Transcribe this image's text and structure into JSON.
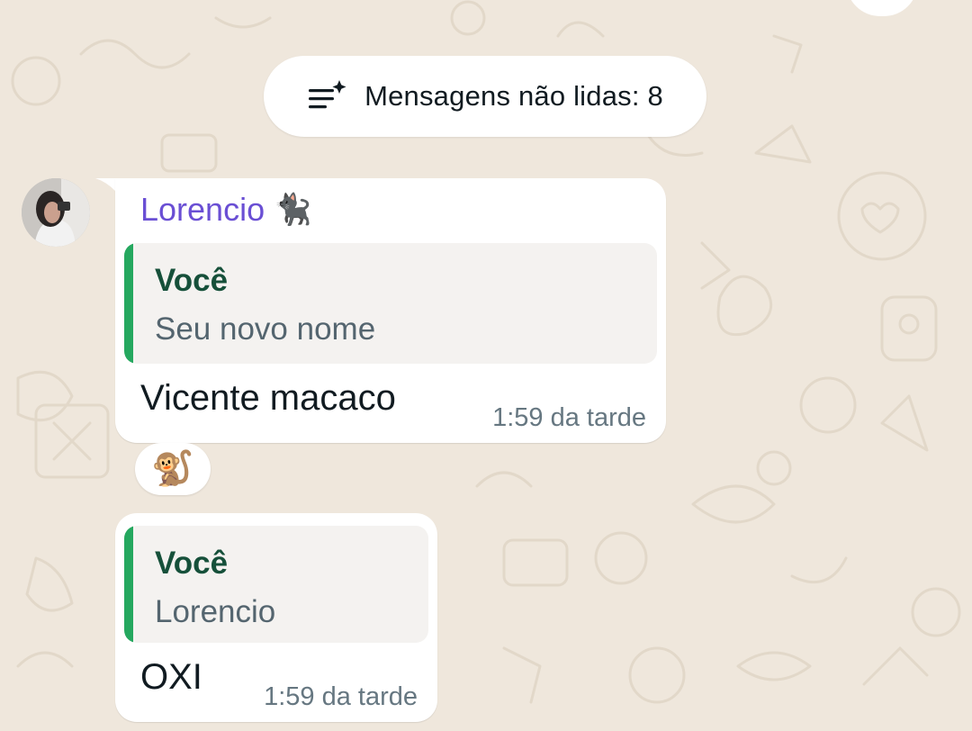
{
  "unread_banner": {
    "icon": "unread-list-sparkle-icon",
    "label": "Mensagens não lidas: 8"
  },
  "message1": {
    "sender": "Lorencio",
    "sender_emoji": "🐈‍⬛",
    "quote": {
      "author": "Você",
      "text": "Seu novo nome"
    },
    "text": "Vicente macaco",
    "time": "1:59 da tarde",
    "reaction": "🐒"
  },
  "message2": {
    "quote": {
      "author": "Você",
      "text": "Lorencio"
    },
    "text": "OXI",
    "time": "1:59 da tarde"
  },
  "colors": {
    "wallpaper": "#efe7dc",
    "sender_name": "#6a4fd4",
    "quote_bar": "#25a85f",
    "quote_author": "#16503a",
    "timestamp": "#667781"
  }
}
